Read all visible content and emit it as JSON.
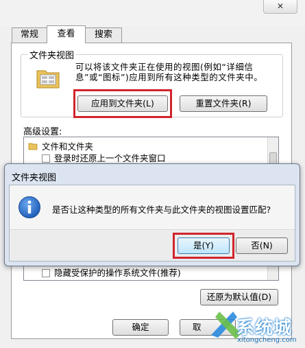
{
  "window": {
    "close_label": "✕",
    "tabs": [
      {
        "label": "常规",
        "active": false
      },
      {
        "label": "查看",
        "active": true
      },
      {
        "label": "搜索",
        "active": false
      }
    ]
  },
  "folder_views": {
    "title": "文件夹视图",
    "description": "可以将该文件夹正在使用的视图(例如“详细信息”或“图标”)应用到所有这种类型的文件夹中。",
    "apply_button": "应用到文件夹(L)",
    "reset_button": "重置文件夹(R)"
  },
  "advanced": {
    "title": "高级设置:",
    "items": [
      "文件和文件夹",
      "登录时还原上一个文件夹窗口",
      "隐藏受保护的操作系统文件(推荐)"
    ],
    "restore_defaults": "还原为默认值(D)"
  },
  "footer": {
    "ok": "确定",
    "cancel": "取"
  },
  "dialog": {
    "title": "文件夹视图",
    "message": "是否让这种类型的所有文件夹与此文件夹的视图设置匹配?",
    "yes": "是(Y)",
    "no": "否(N)"
  },
  "watermark": {
    "brand": "系统城",
    "url": "xitongcheng.com"
  },
  "colors": {
    "highlight": "#d0242c",
    "dialog_frame": "#dbe4f0",
    "info_icon": "#1f5fb8"
  }
}
